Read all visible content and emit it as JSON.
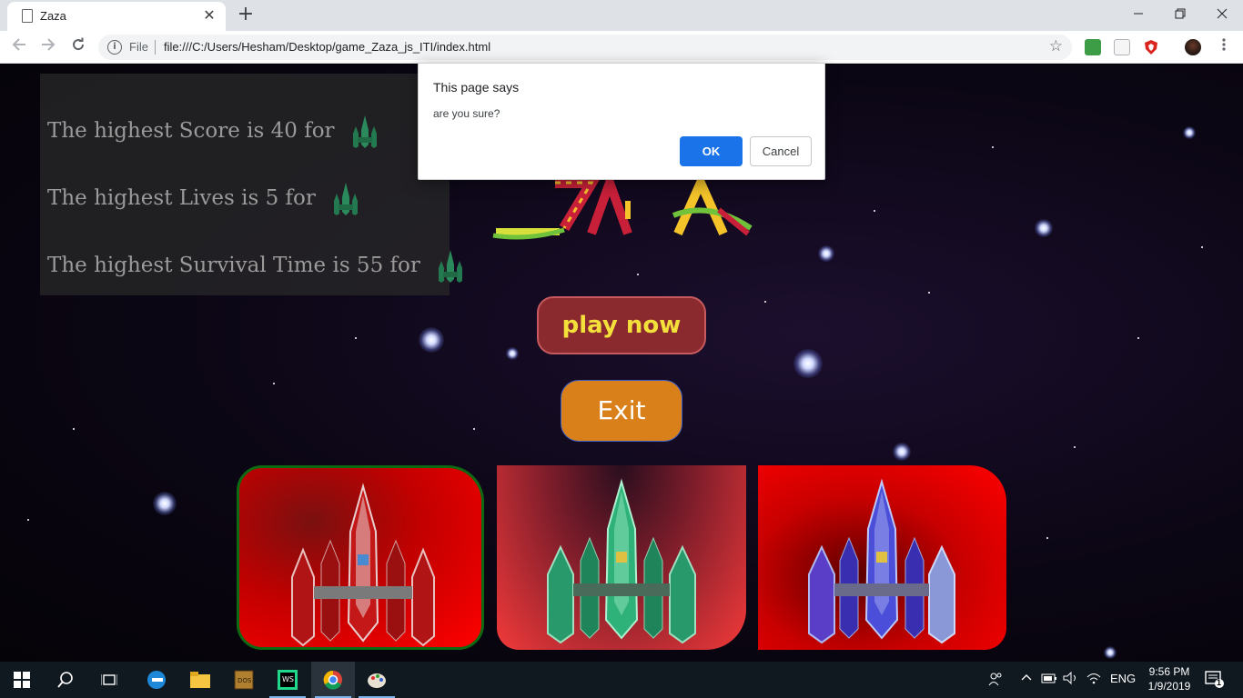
{
  "browser": {
    "tab_title": "Zaza",
    "tab_close": "✕",
    "new_tab": "+",
    "url_scheme": "File",
    "url": "file:///C:/Users/Hesham/Desktop/game_Zaza_js_ITI/index.html"
  },
  "scores": {
    "score_line": "The highest Score is 40 for",
    "lives_line": "The highest Lives is 5 for",
    "time_line": "The highest Survival Time is 55 for"
  },
  "buttons": {
    "play": "play now",
    "exit": "Exit"
  },
  "dialog": {
    "title": "This page says",
    "message": "are you sure?",
    "ok": "OK",
    "cancel": "Cancel"
  },
  "ships": [
    {
      "name": "red-ship",
      "color": "#c41818"
    },
    {
      "name": "green-ship",
      "color": "#2fb27a"
    },
    {
      "name": "blue-ship",
      "color": "#4a4ed8"
    }
  ],
  "taskbar": {
    "language": "ENG",
    "time": "9:56 PM",
    "date": "1/9/2019",
    "notifications": "1"
  },
  "colors": {
    "play_bg": "#8b2a2e",
    "play_text": "#f3e03a",
    "exit_bg": "#d9801a",
    "ok_bg": "#1a73e8"
  }
}
